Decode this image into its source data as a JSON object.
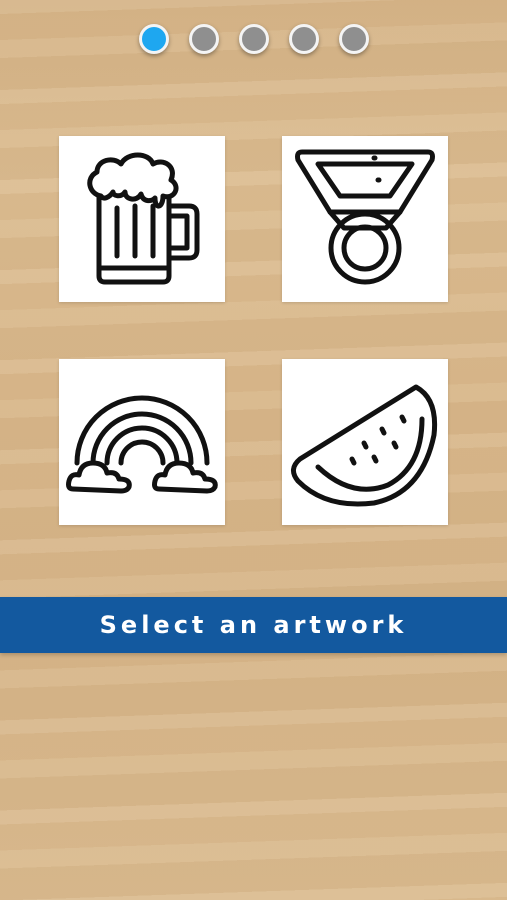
{
  "pager": {
    "active_index": 0,
    "count": 5,
    "colors": {
      "active": "#1ea7f0",
      "inactive": "#8f8f8f"
    }
  },
  "artworks": [
    {
      "icon": "beer-mug-icon"
    },
    {
      "icon": "medal-icon"
    },
    {
      "icon": "rainbow-icon"
    },
    {
      "icon": "watermelon-slice-icon"
    }
  ],
  "banner": {
    "label": "Select an artwork",
    "color": "#13599f"
  }
}
